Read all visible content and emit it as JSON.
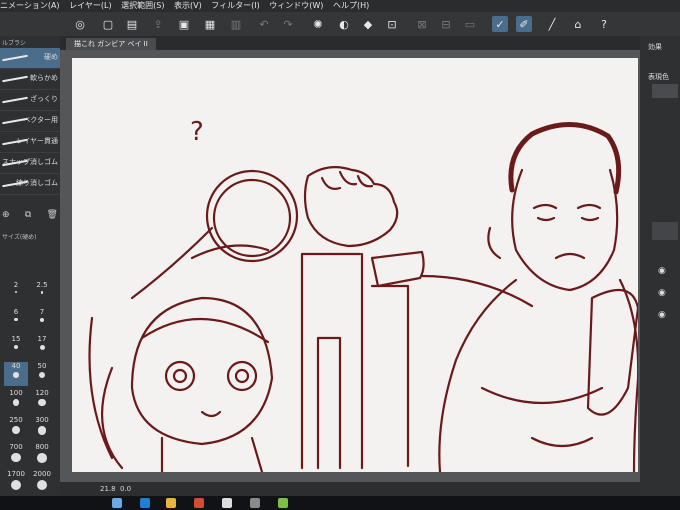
{
  "menu": [
    "ニメーション(A)",
    "レイヤー(L)",
    "選択範囲(S)",
    "表示(V)",
    "フィルター(I)",
    "ウィンドウ(W)",
    "ヘルプ(H)"
  ],
  "document_tab": "描これ ガンビア ベイ II",
  "left_panel": {
    "title": "ルブラシ",
    "brushes": [
      "硬め",
      "軟らかめ",
      "ざっくり",
      "ベクター用",
      "レイヤー貫通",
      "スナップ消しゴム",
      "練り消しゴム"
    ],
    "selected_brush": 0,
    "size_title": "サイズ(硬め)",
    "sizes": [
      "2",
      "2.5",
      "6",
      "7",
      "15",
      "17",
      "40",
      "50",
      "100",
      "120",
      "250",
      "300",
      "700",
      "800",
      "1700",
      "2000"
    ],
    "selected_size": "40"
  },
  "right_panel": {
    "title": "効果",
    "label": "表現色"
  },
  "status": {
    "zoom": "21.8",
    "angle": "0.0"
  },
  "sketch": {
    "question_mark": "?",
    "stroke_color": "#6b1a1a"
  }
}
